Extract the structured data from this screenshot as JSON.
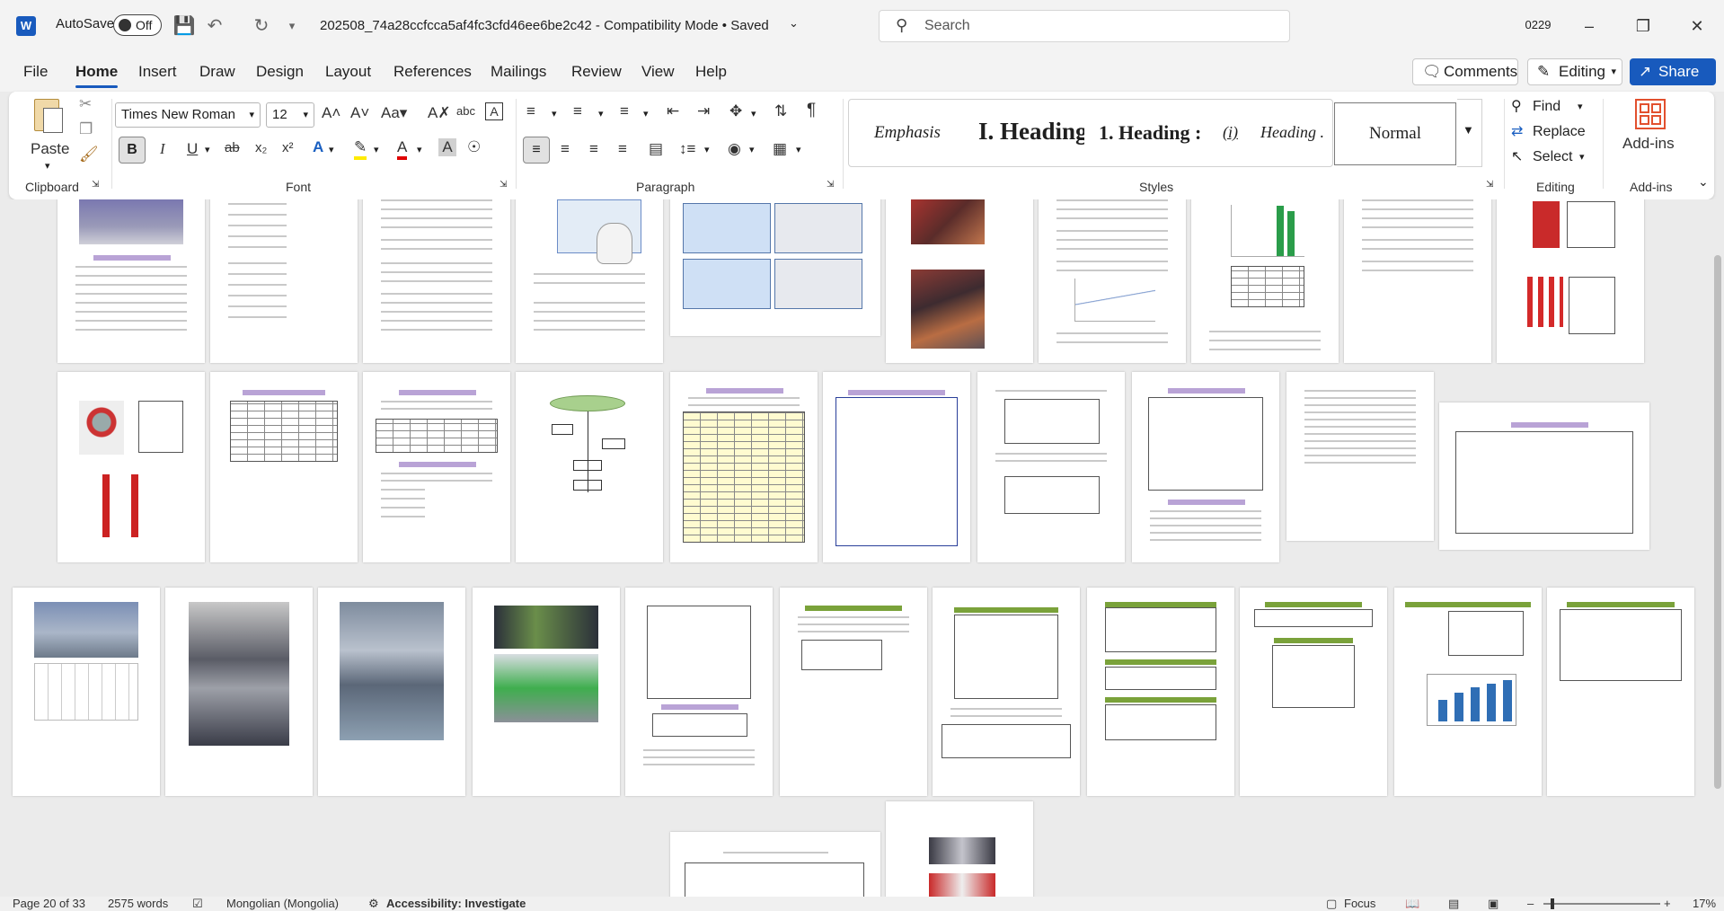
{
  "titlebar": {
    "autosave_label": "AutoSave",
    "autosave_state": "Off",
    "doc_title": "202508_74a28ccfcca5af4fc3cfd46ee6be2c42  -  Compatibility Mode • Saved",
    "search_placeholder": "Search",
    "user_badge": "0229"
  },
  "menu": {
    "tabs": [
      "File",
      "Home",
      "Insert",
      "Draw",
      "Design",
      "Layout",
      "References",
      "Mailings",
      "Review",
      "View",
      "Help"
    ],
    "active": "Home",
    "comments": "Comments",
    "editing": "Editing",
    "share": "Share"
  },
  "ribbon": {
    "clipboard": {
      "paste": "Paste",
      "label": "Clipboard"
    },
    "font": {
      "family": "Times New Roman",
      "size": "12",
      "label": "Font"
    },
    "paragraph": {
      "label": "Paragraph"
    },
    "styles": {
      "label": "Styles",
      "items": [
        "Emphasis",
        "I. Heading",
        "1. Heading :",
        "(i)",
        "Heading .",
        "Normal"
      ]
    },
    "editing": {
      "find": "Find",
      "replace": "Replace",
      "select": "Select",
      "label": "Editing"
    },
    "addins": {
      "addins": "Add-ins",
      "label": "Add-ins"
    }
  },
  "status": {
    "page": "Page 20 of 33",
    "words": "2575 words",
    "language": "Mongolian (Mongolia)",
    "accessibility": "Accessibility: Investigate",
    "focus": "Focus",
    "zoom": "17%"
  },
  "colors": {
    "accent": "#185abd",
    "ribbon_bg": "#ffffff",
    "chrome_bg": "#f3f3f3"
  }
}
